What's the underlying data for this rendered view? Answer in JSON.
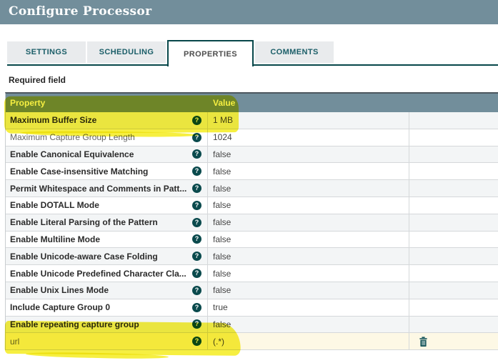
{
  "dialog": {
    "title": "Configure Processor"
  },
  "tabs": [
    {
      "label": "SETTINGS",
      "active": false
    },
    {
      "label": "SCHEDULING",
      "active": false
    },
    {
      "label": "PROPERTIES",
      "active": true
    },
    {
      "label": "COMMENTS",
      "active": false
    }
  ],
  "required_note": "Required field",
  "icons": {
    "help": "?",
    "delete": "trash-icon"
  },
  "colors": {
    "titlebar_bg": "#728e9b",
    "grid_header_bg": "#728e9b",
    "accent_teal": "#07474a",
    "row_alt_bg": "#f3f5f6",
    "dynamic_row_bg": "#fdf8e5",
    "highlight_yellow": "#f6ee30"
  },
  "table": {
    "columns": [
      {
        "label": "Property"
      },
      {
        "label": "Value"
      },
      {
        "label": ""
      }
    ],
    "rows": [
      {
        "name": "Maximum Buffer Size",
        "value": "1 MB",
        "bold": true,
        "dynamic": false,
        "deletable": false
      },
      {
        "name": "Maximum Capture Group Length",
        "value": "1024",
        "bold": false,
        "dynamic": false,
        "deletable": false
      },
      {
        "name": "Enable Canonical Equivalence",
        "value": "false",
        "bold": true,
        "dynamic": false,
        "deletable": false
      },
      {
        "name": "Enable Case-insensitive Matching",
        "value": "false",
        "bold": true,
        "dynamic": false,
        "deletable": false
      },
      {
        "name": "Permit Whitespace and Comments in Patt...",
        "value": "false",
        "bold": true,
        "dynamic": false,
        "deletable": false
      },
      {
        "name": "Enable DOTALL Mode",
        "value": "false",
        "bold": true,
        "dynamic": false,
        "deletable": false
      },
      {
        "name": "Enable Literal Parsing of the Pattern",
        "value": "false",
        "bold": true,
        "dynamic": false,
        "deletable": false
      },
      {
        "name": "Enable Multiline Mode",
        "value": "false",
        "bold": true,
        "dynamic": false,
        "deletable": false
      },
      {
        "name": "Enable Unicode-aware Case Folding",
        "value": "false",
        "bold": true,
        "dynamic": false,
        "deletable": false
      },
      {
        "name": "Enable Unicode Predefined Character Cla...",
        "value": "false",
        "bold": true,
        "dynamic": false,
        "deletable": false
      },
      {
        "name": "Enable Unix Lines Mode",
        "value": "false",
        "bold": true,
        "dynamic": false,
        "deletable": false
      },
      {
        "name": "Include Capture Group 0",
        "value": "true",
        "bold": true,
        "dynamic": false,
        "deletable": false
      },
      {
        "name": "Enable repeating capture group",
        "value": "false",
        "bold": true,
        "dynamic": false,
        "deletable": false
      },
      {
        "name": "url",
        "value": "(.*)",
        "bold": false,
        "dynamic": true,
        "deletable": true
      }
    ]
  }
}
